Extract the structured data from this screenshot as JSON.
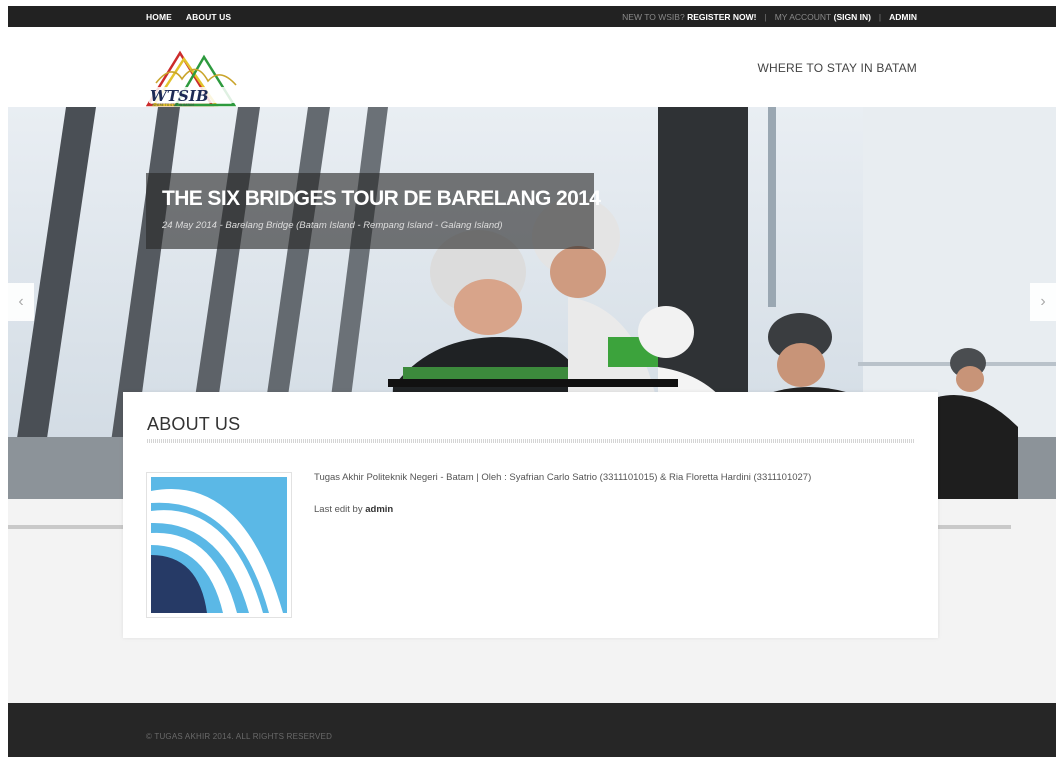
{
  "topbar": {
    "nav": [
      "HOME",
      "ABOUT US"
    ],
    "new_prefix": "NEW TO WSIB?",
    "register": "REGISTER NOW!",
    "account_prefix": "MY ACCOUNT",
    "signin": "(SIGN IN)",
    "admin": "ADMIN"
  },
  "header": {
    "logo_text": "WTSIB",
    "logo_sub": "WHERE TO STAY IN BATAM",
    "tagline": "WHERE TO STAY IN BATAM"
  },
  "slider": {
    "title": "THE SIX BRIDGES TOUR DE BARELANG 2014",
    "subtitle": "24 May 2014 - Barelang Bridge (Batam Island - Rempang Island - Galang Island)",
    "prev_icon": "chevron-left-icon",
    "next_icon": "chevron-right-icon",
    "prev_glyph": "‹",
    "next_glyph": "›"
  },
  "content": {
    "title": "ABOUT US",
    "description": "Tugas Akhir Politeknik Negeri - Batam | Oleh : Syafrian Carlo Satrio (3311101015) & Ria Floretta Hardini (3311101027)",
    "edit_prefix": "Last edit by",
    "editor": "admin"
  },
  "footer": {
    "copyright": "© TUGAS AKHIR 2014. ALL RIGHTS RESERVED"
  },
  "colors": {
    "topbar": "#222222",
    "footer": "#262626",
    "logo_blue": "#5bb8e6",
    "logo_navy": "#263a66"
  }
}
